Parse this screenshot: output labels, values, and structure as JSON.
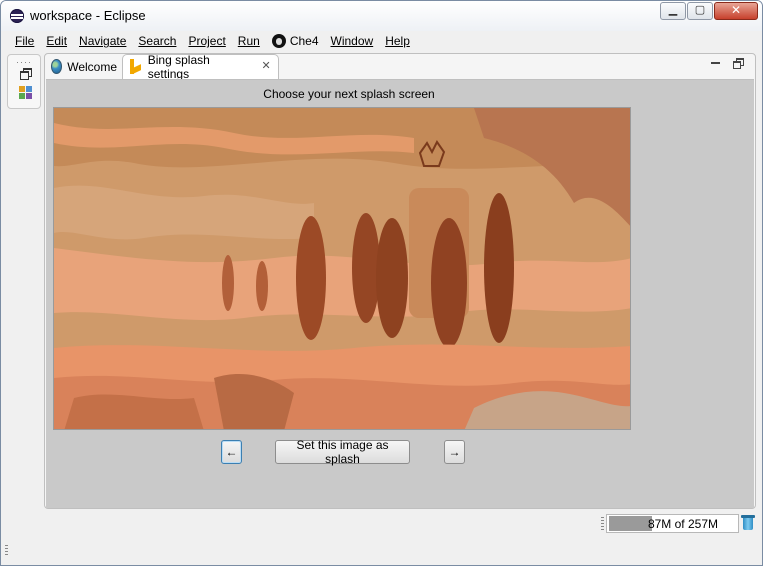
{
  "window": {
    "title": "workspace - Eclipse",
    "minimize_icon": "minimize-icon",
    "maximize_icon": "maximize-icon",
    "close_icon": "close-icon"
  },
  "menu": [
    {
      "label": "File"
    },
    {
      "label": "Edit"
    },
    {
      "label": "Navigate"
    },
    {
      "label": "Search"
    },
    {
      "label": "Project"
    },
    {
      "label": "Run"
    },
    {
      "label": "Che4",
      "icon": "che-icon"
    },
    {
      "label": "Window"
    },
    {
      "label": "Help"
    }
  ],
  "editor": {
    "tabs": [
      {
        "label": "Welcome",
        "icon": "globe-icon",
        "active": false
      },
      {
        "label": "Bing splash settings",
        "icon": "bing-icon",
        "active": true
      }
    ],
    "caption": "Choose your next splash screen",
    "set_button_label": "Set this image as splash",
    "prev_button_label": "←",
    "next_button_label": "→"
  },
  "status": {
    "heap_text": "87M of 257M",
    "heap_used_fraction": 0.34
  },
  "colors": {
    "accent_focus": "#3c7fb1",
    "image_base": "#cf8b5a"
  }
}
